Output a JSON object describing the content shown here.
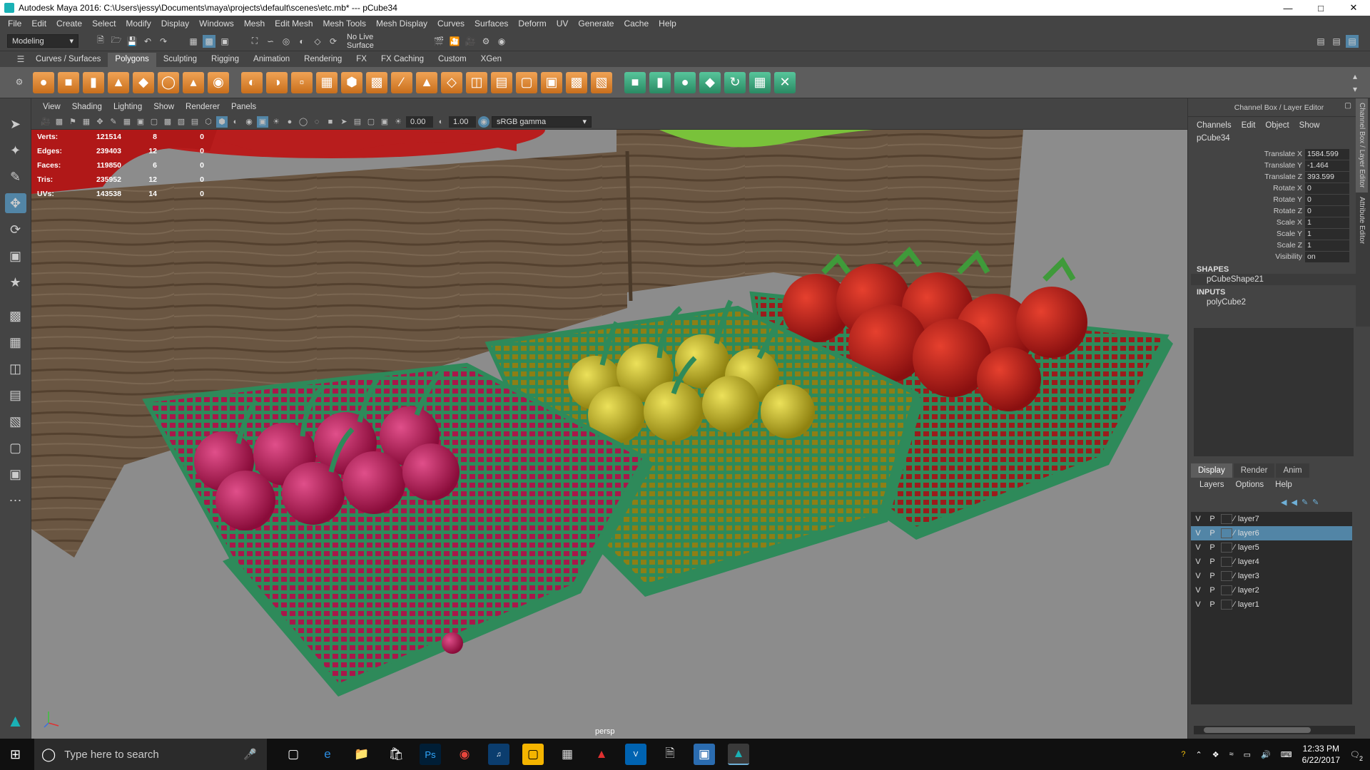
{
  "window": {
    "title": "Autodesk Maya 2016: C:\\Users\\jessy\\Documents\\maya\\projects\\default\\scenes\\etc.mb*   ---   pCube34"
  },
  "menubar": [
    "File",
    "Edit",
    "Create",
    "Select",
    "Modify",
    "Display",
    "Windows",
    "Mesh",
    "Edit Mesh",
    "Mesh Tools",
    "Mesh Display",
    "Curves",
    "Surfaces",
    "Deform",
    "UV",
    "Generate",
    "Cache",
    "Help"
  ],
  "statusline": {
    "mode": "Modeling",
    "live_surface": "No Live Surface"
  },
  "shelf_tabs": [
    "Curves / Surfaces",
    "Polygons",
    "Sculpting",
    "Rigging",
    "Animation",
    "Rendering",
    "FX",
    "FX Caching",
    "Custom",
    "XGen"
  ],
  "panel_menu": [
    "View",
    "Shading",
    "Lighting",
    "Show",
    "Renderer",
    "Panels"
  ],
  "panel_toolbar": {
    "exposure": "0.00",
    "gamma": "1.00",
    "color_space": "sRGB gamma"
  },
  "hud": [
    {
      "label": "Verts:",
      "a": "121514",
      "b": "8",
      "c": "0"
    },
    {
      "label": "Edges:",
      "a": "239403",
      "b": "12",
      "c": "0"
    },
    {
      "label": "Faces:",
      "a": "119850",
      "b": "6",
      "c": "0"
    },
    {
      "label": "Tris:",
      "a": "235952",
      "b": "12",
      "c": "0"
    },
    {
      "label": "UVs:",
      "a": "143538",
      "b": "14",
      "c": "0"
    }
  ],
  "viewport": {
    "camera": "persp"
  },
  "channel_box": {
    "header": "Channel Box / Layer Editor",
    "menu": [
      "Channels",
      "Edit",
      "Object",
      "Show"
    ],
    "object": "pCube34",
    "attributes": [
      {
        "name": "Translate X",
        "value": "1584.599"
      },
      {
        "name": "Translate Y",
        "value": "-1.464"
      },
      {
        "name": "Translate Z",
        "value": "393.599"
      },
      {
        "name": "Rotate X",
        "value": "0"
      },
      {
        "name": "Rotate Y",
        "value": "0"
      },
      {
        "name": "Rotate Z",
        "value": "0"
      },
      {
        "name": "Scale X",
        "value": "1"
      },
      {
        "name": "Scale Y",
        "value": "1"
      },
      {
        "name": "Scale Z",
        "value": "1"
      },
      {
        "name": "Visibility",
        "value": "on"
      }
    ],
    "shapes_label": "SHAPES",
    "shape": "pCubeShape21",
    "inputs_label": "INPUTS",
    "input": "polyCube2",
    "side_tabs": [
      "Channel Box / Layer Editor",
      "Attribute Editor"
    ]
  },
  "layer_editor": {
    "tabs": [
      "Display",
      "Render",
      "Anim"
    ],
    "menu": [
      "Layers",
      "Options",
      "Help"
    ],
    "layers": [
      {
        "v": "V",
        "p": "P",
        "name": "layer7",
        "selected": false
      },
      {
        "v": "V",
        "p": "P",
        "name": "layer6",
        "selected": true
      },
      {
        "v": "V",
        "p": "P",
        "name": "layer5",
        "selected": false
      },
      {
        "v": "V",
        "p": "P",
        "name": "layer4",
        "selected": false
      },
      {
        "v": "V",
        "p": "P",
        "name": "layer3",
        "selected": false
      },
      {
        "v": "V",
        "p": "P",
        "name": "layer2",
        "selected": false
      },
      {
        "v": "V",
        "p": "P",
        "name": "layer1",
        "selected": false
      }
    ]
  },
  "taskbar": {
    "search_placeholder": "Type here to search",
    "time": "12:33 PM",
    "date": "6/22/2017",
    "notifications": "2"
  },
  "colors": {
    "accent": "#5285a6",
    "basket_green": "#2e8a5a",
    "crate_wood": "#6a5642",
    "cherry": "#b3124c",
    "apple_yellow": "#c6b41a",
    "strawberry": "#b81d1d"
  }
}
